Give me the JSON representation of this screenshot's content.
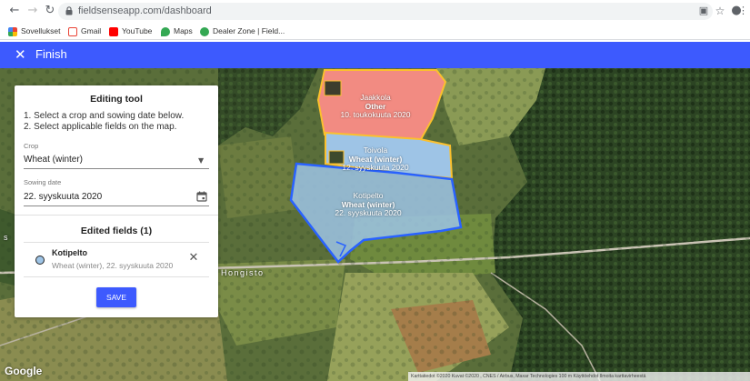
{
  "browser": {
    "url": "fieldsenseapp.com/dashboard",
    "bookmarks": [
      {
        "label": "Sovellukset",
        "color": "#4285f4"
      },
      {
        "label": "Gmail",
        "color": "#ea4335"
      },
      {
        "label": "YouTube",
        "color": "#ff0000"
      },
      {
        "label": "Maps",
        "color": "#34a853"
      },
      {
        "label": "Dealer Zone | Field...",
        "color": "#34a853"
      }
    ]
  },
  "appbar": {
    "finish_label": "Finish",
    "color": "#3d5afe"
  },
  "panel": {
    "title": "Editing tool",
    "step1": "1. Select a crop and sowing date below.",
    "step2": "2. Select applicable fields on the map.",
    "crop_label": "Crop",
    "crop_value": "Wheat (winter)",
    "sowing_label": "Sowing date",
    "sowing_value": "22. syyskuuta 2020",
    "edited_title": "Edited fields (1)",
    "edited_fields": [
      {
        "name": "Kotipelto",
        "detail": "Wheat (winter), 22. syyskuuta 2020"
      }
    ],
    "save_label": "SAVE"
  },
  "map": {
    "fields": [
      {
        "name": "Jaakkola",
        "crop": "Other",
        "date": "10. toukokuuta 2020",
        "color": "#f28b82"
      },
      {
        "name": "Toivola",
        "crop": "Wheat (winter)",
        "date": "12. syyskuuta 2020",
        "color": "#9ec4e6"
      },
      {
        "name": "Kotipelto",
        "crop": "Wheat (winter)",
        "date": "22. syyskuuta 2020",
        "color": "#9ec4e6"
      }
    ],
    "place_label": "Hongisto",
    "place_label_left": "s",
    "google_label": "Google",
    "attribution": "Karttatiedot ©2020 Kuvat ©2020 , CNES / Airbus, Maxar Technologies    100 m            Käyttöehdot    Ilmoita karttavirheestä"
  }
}
